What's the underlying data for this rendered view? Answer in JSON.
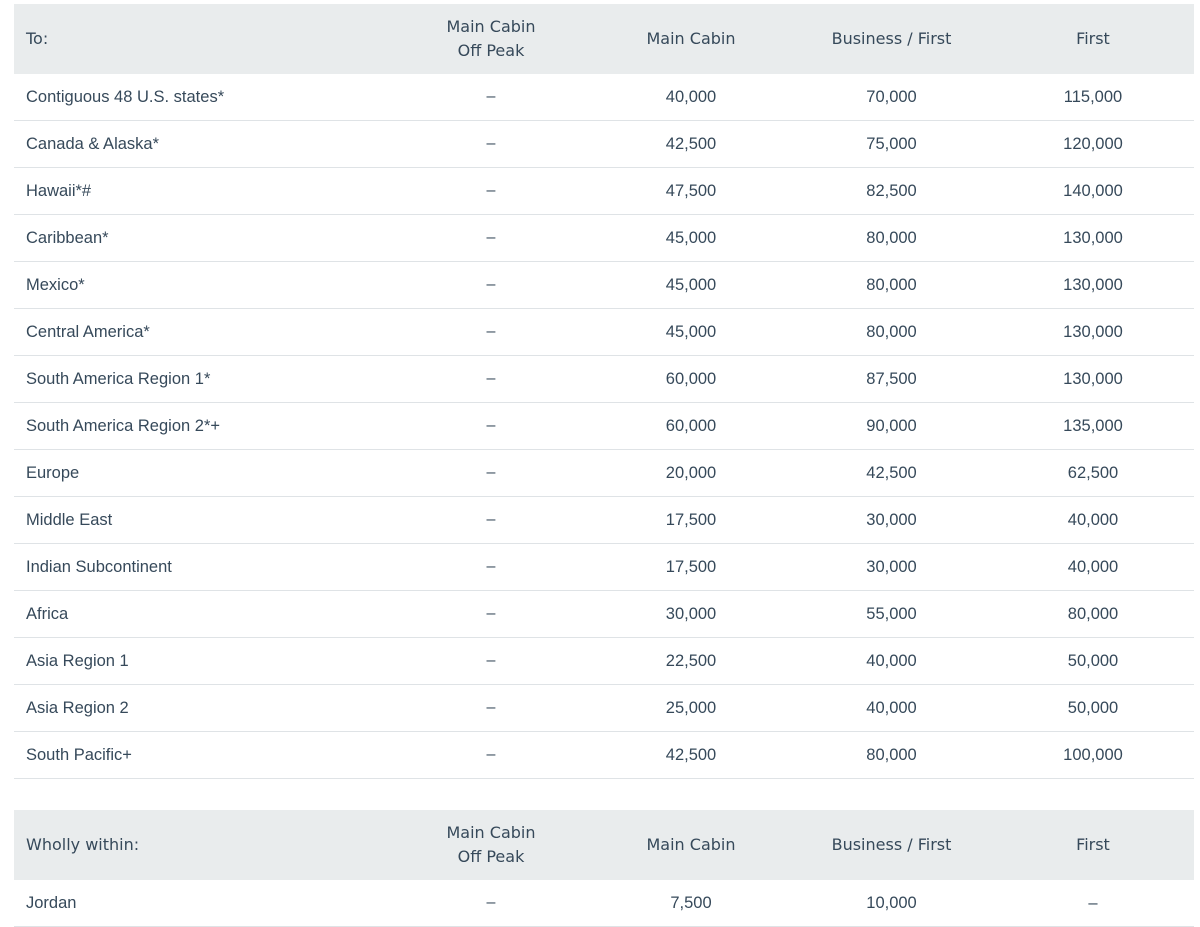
{
  "table_to": {
    "headers": {
      "region": "To:",
      "main_cabin_off_peak_line1": "Main Cabin",
      "main_cabin_off_peak_line2": "Off Peak",
      "main_cabin": "Main Cabin",
      "business_first": "Business / First",
      "first": "First"
    },
    "rows": [
      {
        "region": "Contiguous 48 U.S. states*",
        "off_peak": "–",
        "main_cabin": "40,000",
        "business_first": "70,000",
        "first": "115,000"
      },
      {
        "region": "Canada & Alaska*",
        "off_peak": "–",
        "main_cabin": "42,500",
        "business_first": "75,000",
        "first": "120,000"
      },
      {
        "region": "Hawaii*#",
        "off_peak": "–",
        "main_cabin": "47,500",
        "business_first": "82,500",
        "first": "140,000"
      },
      {
        "region": "Caribbean*",
        "off_peak": "–",
        "main_cabin": "45,000",
        "business_first": "80,000",
        "first": "130,000"
      },
      {
        "region": "Mexico*",
        "off_peak": "–",
        "main_cabin": "45,000",
        "business_first": "80,000",
        "first": "130,000"
      },
      {
        "region": "Central America*",
        "off_peak": "–",
        "main_cabin": "45,000",
        "business_first": "80,000",
        "first": "130,000"
      },
      {
        "region": "South America Region 1*",
        "off_peak": "–",
        "main_cabin": "60,000",
        "business_first": "87,500",
        "first": "130,000"
      },
      {
        "region": "South America Region 2*+",
        "off_peak": "–",
        "main_cabin": "60,000",
        "business_first": "90,000",
        "first": "135,000"
      },
      {
        "region": "Europe",
        "off_peak": "–",
        "main_cabin": "20,000",
        "business_first": "42,500",
        "first": "62,500"
      },
      {
        "region": "Middle East",
        "off_peak": "–",
        "main_cabin": "17,500",
        "business_first": "30,000",
        "first": "40,000"
      },
      {
        "region": "Indian Subcontinent",
        "off_peak": "–",
        "main_cabin": "17,500",
        "business_first": "30,000",
        "first": "40,000"
      },
      {
        "region": "Africa",
        "off_peak": "–",
        "main_cabin": "30,000",
        "business_first": "55,000",
        "first": "80,000"
      },
      {
        "region": "Asia Region 1",
        "off_peak": "–",
        "main_cabin": "22,500",
        "business_first": "40,000",
        "first": "50,000"
      },
      {
        "region": "Asia Region 2",
        "off_peak": "–",
        "main_cabin": "25,000",
        "business_first": "40,000",
        "first": "50,000"
      },
      {
        "region": "South Pacific+",
        "off_peak": "–",
        "main_cabin": "42,500",
        "business_first": "80,000",
        "first": "100,000"
      }
    ]
  },
  "table_within": {
    "headers": {
      "region": "Wholly within:",
      "main_cabin_off_peak_line1": "Main Cabin",
      "main_cabin_off_peak_line2": "Off Peak",
      "main_cabin": "Main Cabin",
      "business_first": "Business / First",
      "first": "First"
    },
    "rows": [
      {
        "region": "Jordan",
        "off_peak": "–",
        "main_cabin": "7,500",
        "business_first": "10,000",
        "first": "–"
      }
    ]
  }
}
